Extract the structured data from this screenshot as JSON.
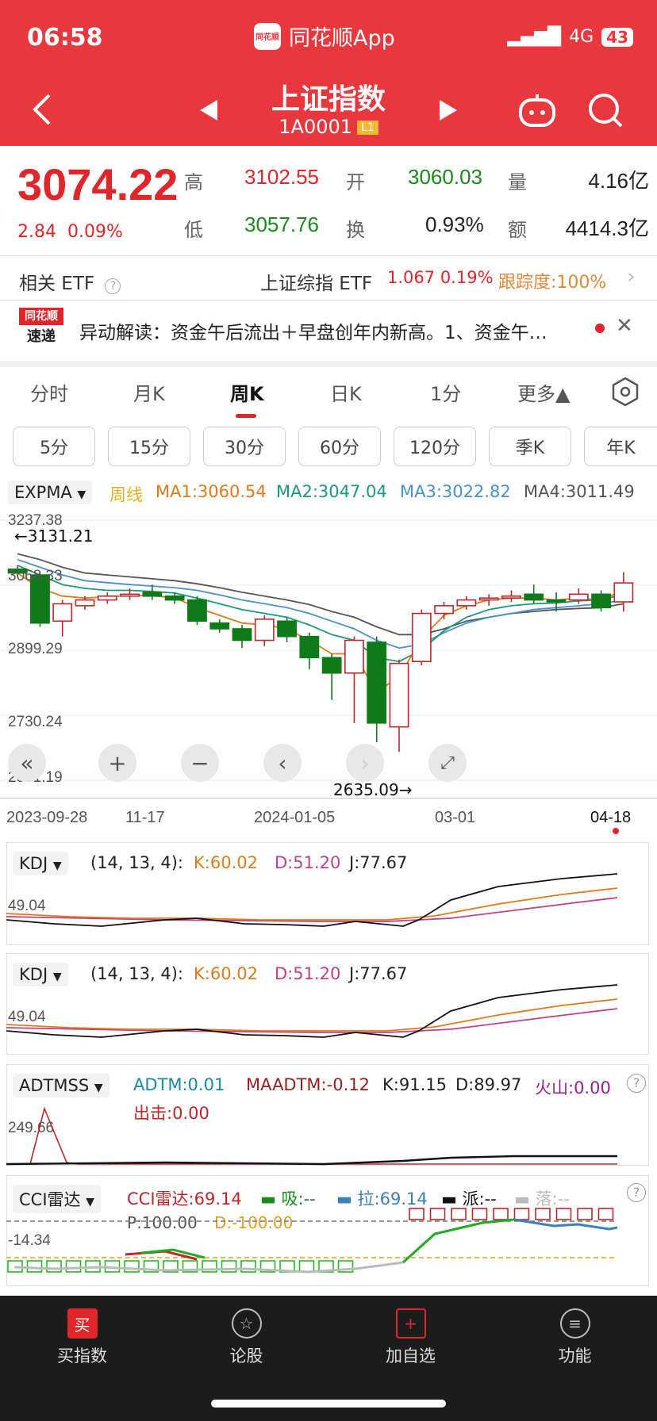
{
  "status_bar": {
    "time": "06:58",
    "app_name": "同花顺App",
    "network": "4G",
    "battery": "43"
  },
  "header": {
    "title": "上证指数",
    "code": "1A0001",
    "level": "L1"
  },
  "quote": {
    "price": "3074.22",
    "change": "2.84",
    "change_pct": "0.09%",
    "high_label": "高",
    "high": "3102.55",
    "open_label": "开",
    "open": "3060.03",
    "vol_label": "量",
    "vol": "4.16亿",
    "low_label": "低",
    "low": "3057.76",
    "turnover_label": "换",
    "turnover": "0.93%",
    "amount_label": "额",
    "amount": "4414.3亿"
  },
  "etf": {
    "label": "相关 ETF",
    "name": "上证综指 ETF",
    "price": "1.067",
    "pct": "0.19%",
    "track": "跟踪度:100%"
  },
  "news": {
    "badge_top": "同花顺",
    "badge_bottom": "速递",
    "text": "异动解读：资金午后流出＋早盘创年内新高。1、资金午…"
  },
  "period_tabs": [
    "分时",
    "月K",
    "周K",
    "日K",
    "1分",
    "更多▲"
  ],
  "interval_pills": [
    "5分",
    "15分",
    "30分",
    "60分",
    "120分",
    "季K",
    "年K"
  ],
  "main_chart": {
    "indicator": "EXPMA",
    "period": "周线",
    "ma1": "MA1:3060.54",
    "ma2": "MA2:3047.04",
    "ma3": "MA3:3022.82",
    "ma4": "MA4:3011.49",
    "y_labels": [
      "3237.38",
      "3068.33",
      "2899.29",
      "2730.24",
      "2561.19"
    ],
    "high_annot": "←3131.21",
    "low_annot": "2635.09→",
    "x_labels": [
      "2023-09-28",
      "11-17",
      "2024-01-05",
      "03-01",
      "04-18"
    ],
    "colors": {
      "up": "#c0262a",
      "down": "#0f7a1a",
      "ma1": "#e07b1c",
      "ma2": "#1a9a7a",
      "ma3": "#4a90d0",
      "ma4": "#555555"
    }
  },
  "chart_data": {
    "type": "candlestick",
    "ylim": [
      2561.19,
      3237.38
    ],
    "candles": [
      {
        "o": 3110,
        "c": 3100,
        "h": 3120,
        "l": 3090
      },
      {
        "o": 3095,
        "c": 2970,
        "h": 3100,
        "l": 2960
      },
      {
        "o": 2975,
        "c": 3020,
        "h": 3030,
        "l": 2935
      },
      {
        "o": 3015,
        "c": 3030,
        "h": 3040,
        "l": 3005
      },
      {
        "o": 3030,
        "c": 3040,
        "h": 3050,
        "l": 3020
      },
      {
        "o": 3040,
        "c": 3045,
        "h": 3060,
        "l": 3030
      },
      {
        "o": 3050,
        "c": 3040,
        "h": 3070,
        "l": 3030
      },
      {
        "o": 3040,
        "c": 3030,
        "h": 3050,
        "l": 3020
      },
      {
        "o": 3030,
        "c": 2975,
        "h": 3040,
        "l": 2965
      },
      {
        "o": 2970,
        "c": 2955,
        "h": 2980,
        "l": 2945
      },
      {
        "o": 2955,
        "c": 2925,
        "h": 2965,
        "l": 2905
      },
      {
        "o": 2925,
        "c": 2980,
        "h": 2990,
        "l": 2910
      },
      {
        "o": 2975,
        "c": 2935,
        "h": 2985,
        "l": 2920
      },
      {
        "o": 2935,
        "c": 2880,
        "h": 2945,
        "l": 2850
      },
      {
        "o": 2880,
        "c": 2840,
        "h": 2890,
        "l": 2770
      },
      {
        "o": 2840,
        "c": 2925,
        "h": 2935,
        "l": 2710
      },
      {
        "o": 2920,
        "c": 2710,
        "h": 2935,
        "l": 2660
      },
      {
        "o": 2700,
        "c": 2865,
        "h": 2875,
        "l": 2635.09
      },
      {
        "o": 2870,
        "c": 2995,
        "h": 3005,
        "l": 2860
      },
      {
        "o": 2995,
        "c": 3015,
        "h": 3025,
        "l": 2980
      },
      {
        "o": 3015,
        "c": 3030,
        "h": 3040,
        "l": 3005
      },
      {
        "o": 3030,
        "c": 3035,
        "h": 3045,
        "l": 3015
      },
      {
        "o": 3035,
        "c": 3040,
        "h": 3055,
        "l": 3025
      },
      {
        "o": 3045,
        "c": 3030,
        "h": 3070,
        "l": 3020
      },
      {
        "o": 3030,
        "c": 3025,
        "h": 3050,
        "l": 3000
      },
      {
        "o": 3030,
        "c": 3045,
        "h": 3060,
        "l": 3020
      },
      {
        "o": 3045,
        "c": 3010,
        "h": 3055,
        "l": 3000
      },
      {
        "o": 3025,
        "c": 3074.22,
        "h": 3102.55,
        "l": 3000
      }
    ],
    "ma1": [
      3100,
      3060,
      3040,
      3035,
      3038,
      3042,
      3041,
      3036,
      3010,
      2990,
      2970,
      2965,
      2955,
      2925,
      2890,
      2890,
      2790,
      2830,
      2930,
      2990,
      3015,
      3030,
      3035,
      3035,
      3030,
      3035,
      3030,
      3055
    ],
    "ma2": [
      3120,
      3095,
      3070,
      3060,
      3055,
      3055,
      3052,
      3048,
      3035,
      3020,
      3005,
      2995,
      2985,
      2965,
      2940,
      2925,
      2880,
      2870,
      2900,
      2950,
      2985,
      3005,
      3015,
      3020,
      3022,
      3028,
      3030,
      3045
    ],
    "ma3": [
      3135,
      3115,
      3095,
      3080,
      3075,
      3070,
      3066,
      3062,
      3055,
      3043,
      3030,
      3020,
      3010,
      2995,
      2975,
      2955,
      2925,
      2905,
      2915,
      2945,
      2970,
      2985,
      2995,
      3005,
      3010,
      3015,
      3020,
      3030
    ],
    "ma4": [
      3150,
      3135,
      3115,
      3100,
      3095,
      3090,
      3085,
      3080,
      3072,
      3062,
      3050,
      3040,
      3030,
      3018,
      3000,
      2985,
      2960,
      2940,
      2940,
      2955,
      2975,
      2985,
      2995,
      3000,
      3005,
      3008,
      3010,
      3020
    ]
  },
  "kdj1": {
    "name": "KDJ",
    "params": "(14, 13, 4):",
    "k": "K:60.02",
    "d": "D:51.20",
    "j": "J:77.67",
    "y_label": "49.04"
  },
  "kdj2": {
    "name": "KDJ",
    "params": "(14, 13, 4):",
    "k": "K:60.02",
    "d": "D:51.20",
    "j": "J:77.67",
    "y_label": "49.04"
  },
  "adtm": {
    "name": "ADTMSS",
    "adtm": "ADTM:0.01",
    "maadtm": "MAADTM:-0.12",
    "k": "K:91.15",
    "d": "D:89.97",
    "volcano": "火山:0.00",
    "strike": "出击:0.00",
    "y_label": "249.66"
  },
  "cci": {
    "name": "CCI雷达",
    "val": "CCI雷达:69.14",
    "xi": "吸:--",
    "la": "拉:69.14",
    "pai": "派:--",
    "luo": "落:--",
    "p_line": "P:100.00",
    "d_line": "D:-100.00",
    "y_label": "-14.34"
  },
  "bottom_nav": [
    {
      "label": "买指数",
      "icon": "买"
    },
    {
      "label": "论股",
      "icon": "☆"
    },
    {
      "label": "加自选",
      "icon": "+"
    },
    {
      "label": "功能",
      "icon": "≡"
    }
  ]
}
